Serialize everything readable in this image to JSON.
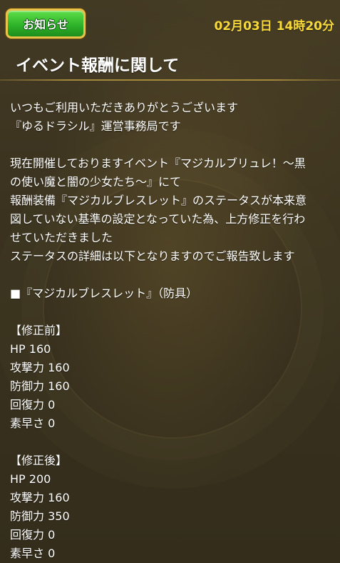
{
  "header": {
    "badge_label": "お知らせ",
    "timestamp": "02月03日 14時20分"
  },
  "title": "イベント報酬に関して",
  "body": {
    "intro_1": "いつもご利用いただきありがとうございます",
    "intro_2": "『ゆるドラシル』運営事務局です",
    "para_1": "現在開催しておりますイベント『マジカルブリュレ！〜黒",
    "para_2": "の使い魔と闇の少女たち〜』にて",
    "para_3": "報酬装備『マジカルブレスレット』のステータスが本来意",
    "para_4": "図していない基準の設定となっていた為、上方修正を行わ",
    "para_5": "せていただきました",
    "para_6": "ステータスの詳細は以下となりますのでご報告致します",
    "item_heading": "■『マジカルブレスレット』（防具）",
    "before_heading": "【修正前】",
    "before_stats": [
      "HP 160",
      "攻撃力 160",
      "防御力 160",
      "回復力 0",
      "素早さ 0"
    ],
    "after_heading": "【修正後】",
    "after_stats": [
      "HP 200",
      "攻撃力 160",
      "防御力 350",
      "回復力 0",
      "素早さ 0"
    ]
  },
  "colors": {
    "background": "#3b3320",
    "timestamp": "#f7d93c",
    "badge_green": "#2fb32a",
    "badge_border": "#e9c24a"
  }
}
